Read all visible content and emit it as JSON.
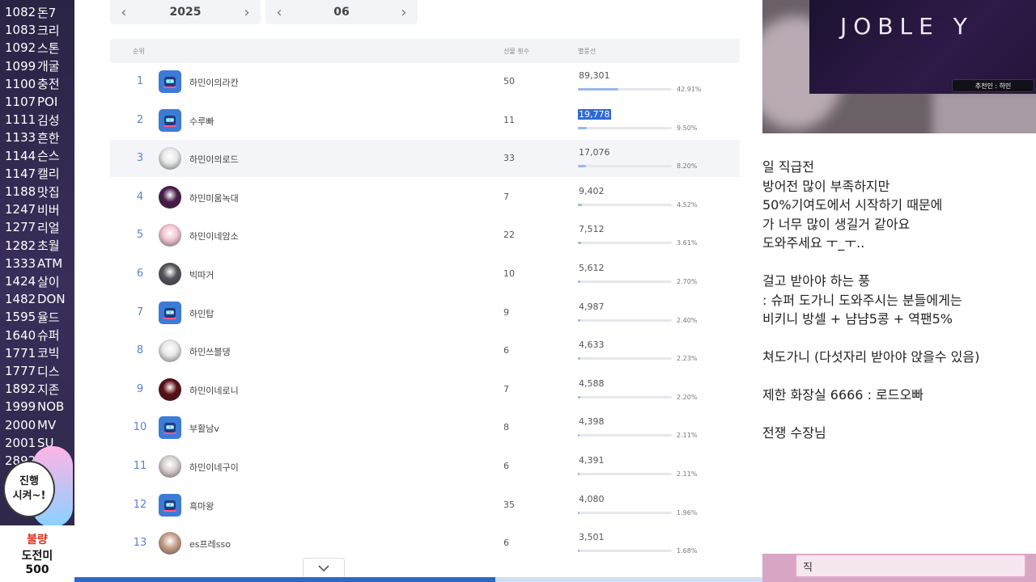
{
  "left_overlay": {
    "rows": [
      {
        "num": "1082",
        "name": "돈7"
      },
      {
        "num": "1083",
        "name": "크리"
      },
      {
        "num": "1092",
        "name": "스톤"
      },
      {
        "num": "1099",
        "name": "개굴"
      },
      {
        "num": "1100",
        "name": "충전"
      },
      {
        "num": "1107",
        "name": "POI"
      },
      {
        "num": "1111",
        "name": "김성"
      },
      {
        "num": "1133",
        "name": "흔한"
      },
      {
        "num": "1144",
        "name": "슨스"
      },
      {
        "num": "1147",
        "name": "캘리"
      },
      {
        "num": "1188",
        "name": "맛집"
      },
      {
        "num": "1247",
        "name": "비버"
      },
      {
        "num": "1277",
        "name": "리얼"
      },
      {
        "num": "1282",
        "name": "초월"
      },
      {
        "num": "1333",
        "name": "ATM"
      },
      {
        "num": "1424",
        "name": "살이"
      },
      {
        "num": "1482",
        "name": "DON"
      },
      {
        "num": "1595",
        "name": "율드"
      },
      {
        "num": "1640",
        "name": "슈퍼"
      },
      {
        "num": "1771",
        "name": "코빅"
      },
      {
        "num": "1777",
        "name": "디스"
      },
      {
        "num": "1892",
        "name": "지존"
      },
      {
        "num": "1999",
        "name": "NOB"
      },
      {
        "num": "2000",
        "name": "MV"
      },
      {
        "num": "2001",
        "name": "SU"
      },
      {
        "num": "2892",
        "name": ""
      }
    ],
    "bubble_line1": "진행",
    "bubble_line2": "시켜~!",
    "bottom_card": {
      "line1": "불량",
      "line2": "도전미",
      "line3": "500"
    }
  },
  "date_nav": {
    "year": "2025",
    "month": "06"
  },
  "table": {
    "headers": {
      "rank": "순위",
      "count": "선물 횟수",
      "amount": "별풍선"
    },
    "rows": [
      {
        "rank": "1",
        "name": "하민이의라칸",
        "count": "50",
        "amount": "89,301",
        "pct": "42.91%",
        "ratio": 0.4291,
        "avatar": "#3c7bd8",
        "avatar_icon": "robot-icon"
      },
      {
        "rank": "2",
        "name": "수루빠",
        "count": "11",
        "amount": "19,778",
        "pct": "9.50%",
        "ratio": 0.095,
        "avatar": "#3c7bd8",
        "avatar_icon": "robot-icon"
      },
      {
        "rank": "3",
        "name": "하민이의로드",
        "count": "33",
        "amount": "17,076",
        "pct": "8.20%",
        "ratio": 0.082,
        "avatar": "#e8e8ea",
        "avatar_icon": "profile-photo"
      },
      {
        "rank": "4",
        "name": "하민미움녹대",
        "count": "7",
        "amount": "9,402",
        "pct": "4.52%",
        "ratio": 0.0452,
        "avatar": "#4a1e4c",
        "avatar_icon": "profile-photo"
      },
      {
        "rank": "5",
        "name": "하민이네암소",
        "count": "22",
        "amount": "7,512",
        "pct": "3.61%",
        "ratio": 0.0361,
        "avatar": "#f2c6d2",
        "avatar_icon": "profile-photo"
      },
      {
        "rank": "6",
        "name": "빅따거",
        "count": "10",
        "amount": "5,612",
        "pct": "2.70%",
        "ratio": 0.027,
        "avatar": "#55555c",
        "avatar_icon": "profile-photo"
      },
      {
        "rank": "7",
        "name": "하민탑",
        "count": "9",
        "amount": "4,987",
        "pct": "2.40%",
        "ratio": 0.024,
        "avatar": "#3c7bd8",
        "avatar_icon": "robot-icon"
      },
      {
        "rank": "8",
        "name": "하민쓰블댕",
        "count": "6",
        "amount": "4,633",
        "pct": "2.23%",
        "ratio": 0.0223,
        "avatar": "#e8e8ea",
        "avatar_icon": "profile-photo"
      },
      {
        "rank": "9",
        "name": "하민이네로니",
        "count": "7",
        "amount": "4,588",
        "pct": "2.20%",
        "ratio": 0.022,
        "avatar": "#5a0e16",
        "avatar_icon": "profile-photo"
      },
      {
        "rank": "10",
        "name": "부활남v",
        "count": "8",
        "amount": "4,398",
        "pct": "2.11%",
        "ratio": 0.0211,
        "avatar": "#3c7bd8",
        "avatar_icon": "robot-icon"
      },
      {
        "rank": "11",
        "name": "하민이네구이",
        "count": "6",
        "amount": "4,391",
        "pct": "2.11%",
        "ratio": 0.0211,
        "avatar": "#d9cfcf",
        "avatar_icon": "profile-photo"
      },
      {
        "rank": "12",
        "name": "흑마왕",
        "count": "35",
        "amount": "4,080",
        "pct": "1.96%",
        "ratio": 0.0196,
        "avatar": "#3c7bd8",
        "avatar_icon": "robot-icon"
      },
      {
        "rank": "13",
        "name": "es프레sso",
        "count": "6",
        "amount": "3,501",
        "pct": "1.68%",
        "ratio": 0.0168,
        "avatar": "#c7a08c",
        "avatar_icon": "profile-photo"
      }
    ]
  },
  "brand": {
    "text": "JOBLE  Y",
    "rec_label": "추천인 : 하민"
  },
  "notes": [
    "일 직급전",
    " 방어전 많이 부족하지만",
    " 50%기여도에서 시작하기 때문에",
    "가 너무 많이 생길거 같아요",
    " 도와주세요 ㅜ_ㅜ..",
    "",
    "걸고 받아야 하는 풍",
    " : 슈퍼 도가니 도와주시는 분들에게는",
    " 비키니 방셀 + 냠냠5콩 + 역팬5%",
    "",
    "쳐도가니 (다섯자리 받아야 앉을수 있음)",
    "",
    "제한 화장실 6666 : 로드오빠",
    "",
    "전쟁 수장님"
  ],
  "bottom_right_text": "직",
  "colors": {
    "accent": "#2f68d6",
    "rank": "#5a7fd6",
    "bar": "#9bb6e8"
  }
}
